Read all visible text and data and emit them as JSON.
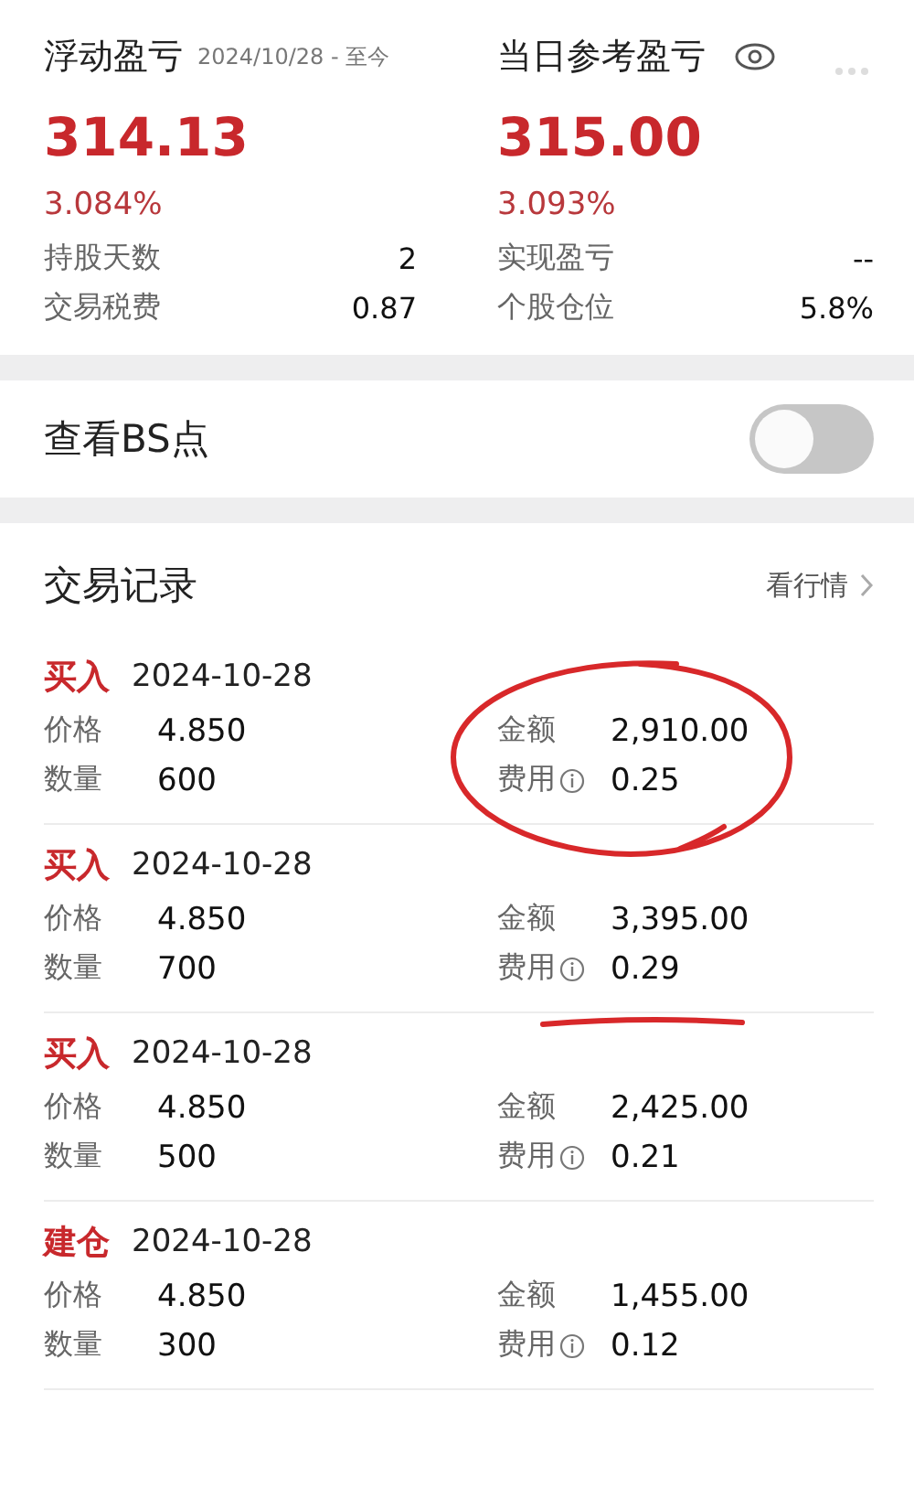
{
  "summary": [
    {
      "kind": "floating",
      "title": "浮动盈亏",
      "subtitle": "2024/10/28 - 至今",
      "value": "314.13",
      "percent": "3.084%",
      "stats": [
        {
          "label": "持股天数",
          "value": "2"
        },
        {
          "label": "交易税费",
          "value": "0.87"
        }
      ]
    },
    {
      "kind": "daily",
      "title": "当日参考盈亏",
      "value": "315.00",
      "percent": "3.093%",
      "stats": [
        {
          "label": "实现盈亏",
          "value": "--"
        },
        {
          "label": "个股仓位",
          "value": "5.8%"
        }
      ]
    }
  ],
  "bs_toggle": {
    "label": "查看BS点",
    "on": false
  },
  "records_section": {
    "title": "交易记录",
    "link": "看行情",
    "records": [
      {
        "type": "买入",
        "date": "2024-10-28",
        "price_label": "价格",
        "price": "4.850",
        "qty_label": "数量",
        "qty": "600",
        "amount_label": "金额",
        "amount": "2,910.00",
        "fee_label": "费用",
        "fee": "0.25",
        "circled": true
      },
      {
        "type": "买入",
        "date": "2024-10-28",
        "price_label": "价格",
        "price": "4.850",
        "qty_label": "数量",
        "qty": "700",
        "amount_label": "金额",
        "amount": "3,395.00",
        "fee_label": "费用",
        "fee": "0.29",
        "underlined": true
      },
      {
        "type": "买入",
        "date": "2024-10-28",
        "price_label": "价格",
        "price": "4.850",
        "qty_label": "数量",
        "qty": "500",
        "amount_label": "金额",
        "amount": "2,425.00",
        "fee_label": "费用",
        "fee": "0.21"
      },
      {
        "type": "建仓",
        "date": "2024-10-28",
        "price_label": "价格",
        "price": "4.850",
        "qty_label": "数量",
        "qty": "300",
        "amount_label": "金额",
        "amount": "1,455.00",
        "fee_label": "费用",
        "fee": "0.12"
      }
    ]
  }
}
